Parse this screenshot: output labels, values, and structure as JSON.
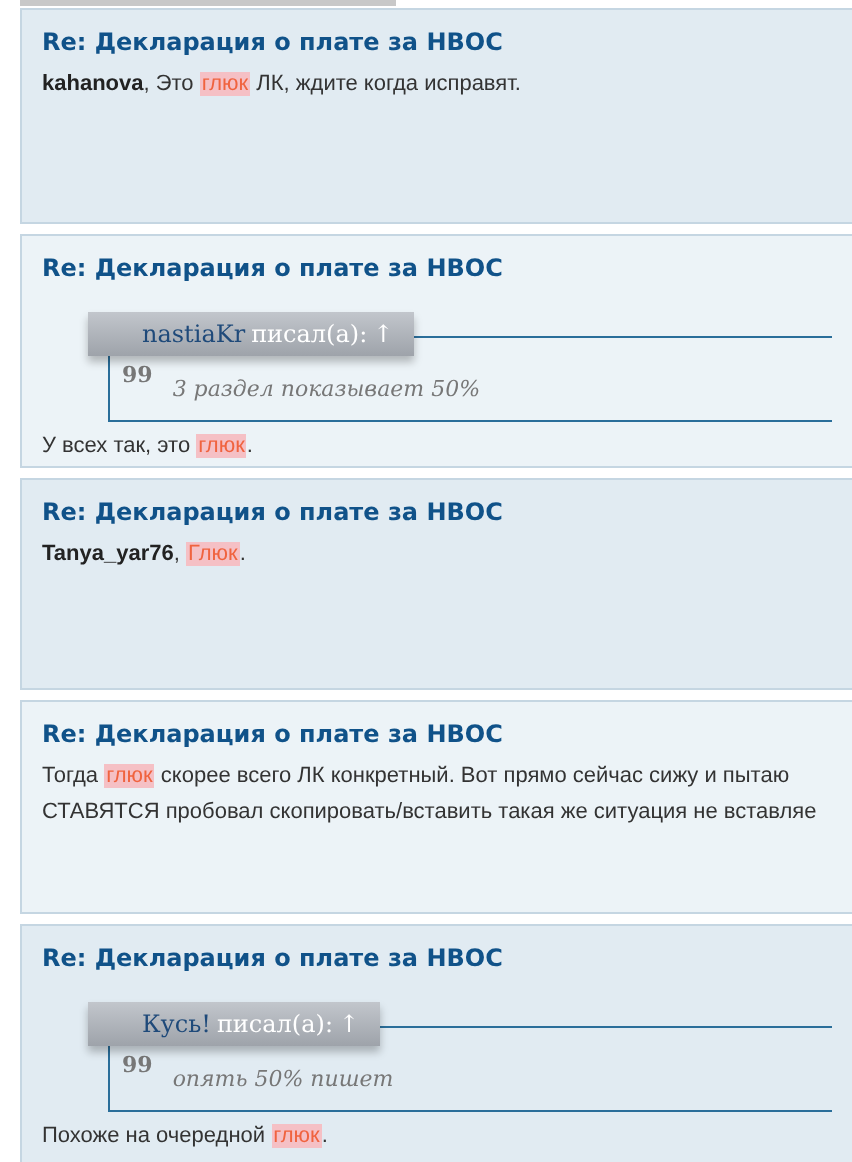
{
  "posts": [
    {
      "title": "Re: Декларация о плате за НВОС",
      "lines": [
        [
          {
            "kind": "user",
            "text": "kahanova"
          },
          {
            "kind": "text",
            "text": ", Это "
          },
          {
            "kind": "highlight",
            "text": "глюк"
          },
          {
            "kind": "text",
            "text": " ЛК, ждите когда исправят."
          }
        ]
      ]
    },
    {
      "title": "Re: Декларация о плате за НВОС",
      "quote": {
        "author": "nastiaKr",
        "wrote": "писал(а):",
        "arrow": "↑",
        "mark": "99",
        "text": "3 раздел показывает 50%"
      },
      "lines": [
        [
          {
            "kind": "text",
            "text": "У всех так, это "
          },
          {
            "kind": "highlight",
            "text": "глюк"
          },
          {
            "kind": "text",
            "text": "."
          }
        ]
      ]
    },
    {
      "title": "Re: Декларация о плате за НВОС",
      "lines": [
        [
          {
            "kind": "user",
            "text": "Tanya_yar76"
          },
          {
            "kind": "text",
            "text": ", "
          },
          {
            "kind": "highlight",
            "text": "Глюк"
          },
          {
            "kind": "text",
            "text": "."
          }
        ]
      ]
    },
    {
      "title": "Re: Декларация о плате за НВОС",
      "lines": [
        [
          {
            "kind": "text",
            "text": "Тогда "
          },
          {
            "kind": "highlight",
            "text": "глюк"
          },
          {
            "kind": "text",
            "text": " скорее всего ЛК конкретный. Вот прямо сейчас сижу и пытаю"
          }
        ],
        [
          {
            "kind": "text",
            "text": "СТАВЯТСЯ пробовал скопировать/вставить такая же ситуация не вставляе"
          }
        ]
      ]
    },
    {
      "title": "Re: Декларация о плате за НВОС",
      "quote": {
        "author": "Кусь!",
        "wrote": "писал(а):",
        "arrow": "↑",
        "mark": "99",
        "text": "опять 50% пишет"
      },
      "lines": [
        [
          {
            "kind": "text",
            "text": "Похоже на очередной "
          },
          {
            "kind": "highlight",
            "text": "глюк"
          },
          {
            "kind": "text",
            "text": "."
          }
        ]
      ]
    }
  ]
}
